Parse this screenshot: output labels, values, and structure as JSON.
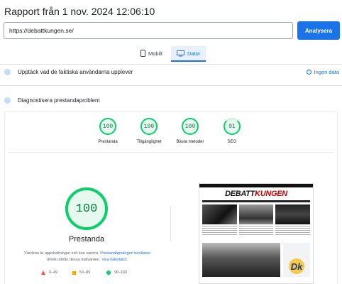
{
  "header": {
    "title": "Rapport från 1 nov. 2024 12:06:10"
  },
  "search": {
    "url": "https://debattkungen.se/",
    "analyze_label": "Analysera"
  },
  "device_tabs": {
    "mobile": "Mobilt",
    "desktop": "Dator",
    "active": "desktop"
  },
  "field_data": {
    "heading": "Upptäck vad de faktiska användarna upplever",
    "no_data": "Ingen data"
  },
  "lab": {
    "heading": "Diagnostisera prestandaproblem"
  },
  "scores": [
    {
      "value": "100",
      "label": "Prestanda"
    },
    {
      "value": "100",
      "label": "Tillgänglighet"
    },
    {
      "value": "100",
      "label": "Bästa metoder"
    },
    {
      "value": "91",
      "label": "SEO"
    }
  ],
  "performance": {
    "score": "100",
    "label": "Prestanda",
    "note_text": "Värdena är uppskattningar och kan variera.",
    "note_link1": "Prestandapoängen beräknas",
    "note_text2": "direkt utifrån dessa mätvärden.",
    "note_link2": "Visa kalkylator."
  },
  "legend": {
    "poor": "0–49",
    "average": "50–89",
    "good": "90–100"
  },
  "screenshot": {
    "site_logo_left": "DEBATT",
    "site_logo_right": "KUNGEN",
    "badge": "Dk"
  },
  "colors": {
    "accent": "#1a73e8",
    "good": "#0cce6b",
    "average": "#ffa400",
    "poor": "#ff4e42"
  }
}
